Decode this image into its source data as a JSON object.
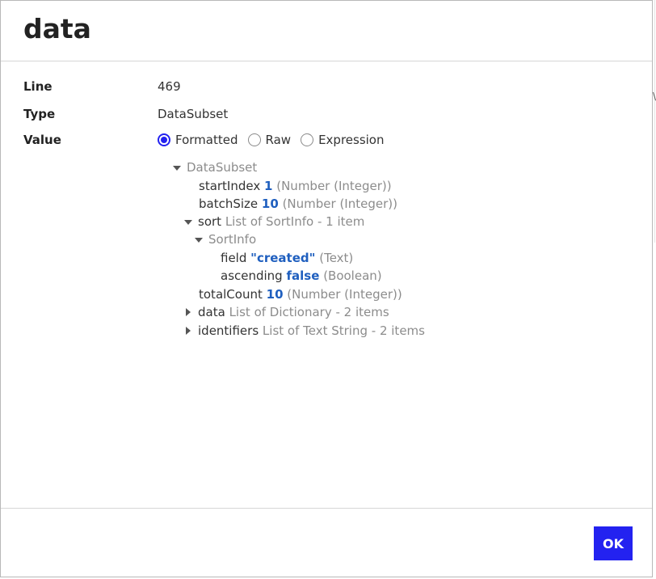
{
  "dialog": {
    "title": "data",
    "ok_label": "OK"
  },
  "fields": {
    "line_label": "Line",
    "line_value": "469",
    "type_label": "Type",
    "type_value": "DataSubset",
    "value_label": "Value"
  },
  "view_modes": {
    "selected": "Formatted",
    "options": [
      "Formatted",
      "Raw",
      "Expression"
    ]
  },
  "tree": {
    "root": "DataSubset",
    "startIndex": {
      "key": "startIndex",
      "value": "1",
      "type": "(Number (Integer))"
    },
    "batchSize": {
      "key": "batchSize",
      "value": "10",
      "type": "(Number (Integer))"
    },
    "sort": {
      "key": "sort",
      "desc": "List of SortInfo - 1 item",
      "item": {
        "name": "SortInfo",
        "field": {
          "key": "field",
          "value": "\"created\"",
          "type": "(Text)"
        },
        "ascending": {
          "key": "ascending",
          "value": "false",
          "type": "(Boolean)"
        }
      }
    },
    "totalCount": {
      "key": "totalCount",
      "value": "10",
      "type": "(Number (Integer))"
    },
    "data": {
      "key": "data",
      "desc": "List of Dictionary - 2 items"
    },
    "identifiers": {
      "key": "identifiers",
      "desc": "List of Text String - 2 items"
    }
  },
  "colors": {
    "accent": "#2322f0",
    "value_blue": "#1f5fbf",
    "muted": "#8c8c8c"
  }
}
